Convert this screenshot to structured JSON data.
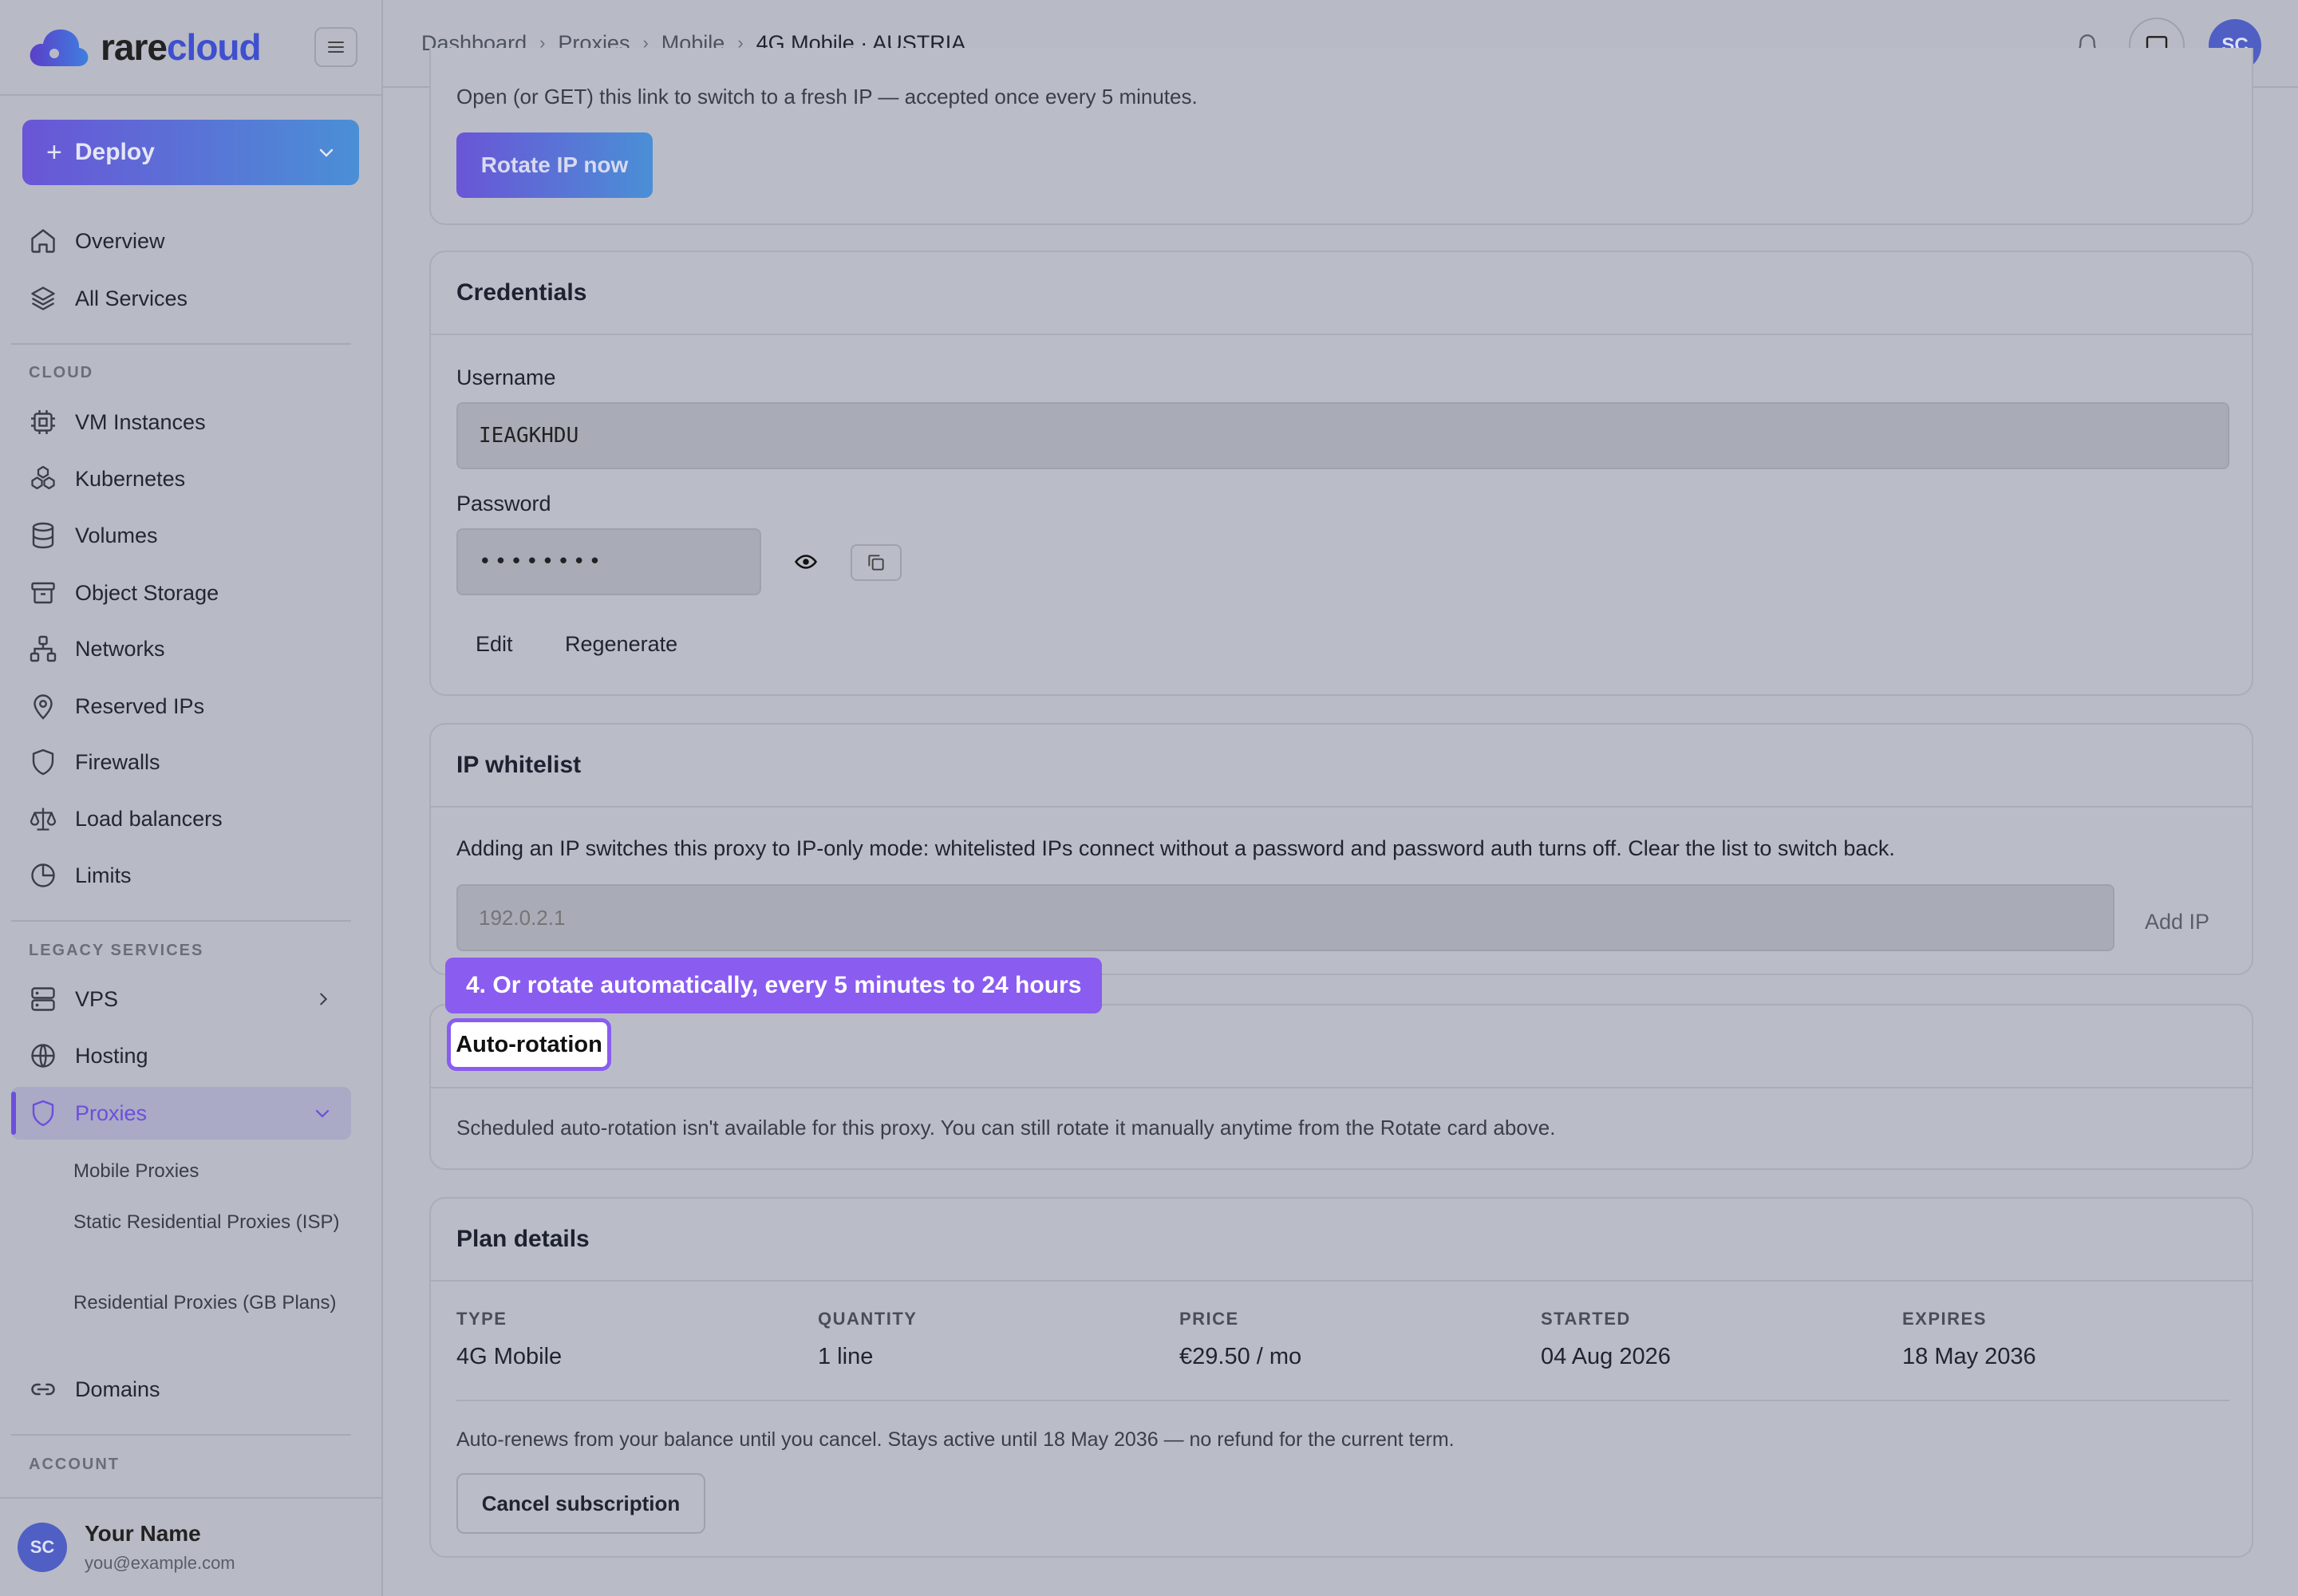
{
  "brand": {
    "name_a": "rare",
    "name_b": "cloud"
  },
  "sidebar": {
    "deploy_label": "Deploy",
    "top_items": [
      {
        "label": "Overview",
        "icon": "home-icon"
      },
      {
        "label": "All Services",
        "icon": "layers-icon"
      }
    ],
    "cloud_label": "CLOUD",
    "cloud_items": [
      {
        "label": "VM Instances",
        "icon": "cpu-icon"
      },
      {
        "label": "Kubernetes",
        "icon": "kubernetes-icon"
      },
      {
        "label": "Volumes",
        "icon": "database-icon"
      },
      {
        "label": "Object Storage",
        "icon": "archive-icon"
      },
      {
        "label": "Networks",
        "icon": "network-icon"
      },
      {
        "label": "Reserved IPs",
        "icon": "map-pin-icon"
      },
      {
        "label": "Firewalls",
        "icon": "shield-icon"
      },
      {
        "label": "Load balancers",
        "icon": "scale-icon"
      },
      {
        "label": "Limits",
        "icon": "pie-chart-icon"
      }
    ],
    "legacy_label": "LEGACY SERVICES",
    "legacy_items": [
      {
        "label": "VPS",
        "icon": "server-icon"
      },
      {
        "label": "Hosting",
        "icon": "globe-icon"
      },
      {
        "label": "Proxies",
        "icon": "shield-icon"
      }
    ],
    "proxy_sub_items": [
      "Mobile Proxies",
      "Static Residential Proxies (ISP)",
      "Residential Proxies (GB Plans)"
    ],
    "domains_label": "Domains",
    "account_label": "ACCOUNT",
    "user": {
      "initials": "SC",
      "name": "Your Name",
      "email": "you@example.com"
    }
  },
  "header": {
    "breadcrumb": [
      "Dashboard",
      "Proxies",
      "Mobile",
      "4G Mobile · AUSTRIA"
    ],
    "avatar_initials": "SC"
  },
  "rotate_card": {
    "hint": "Open (or GET) this link to switch to a fresh IP — accepted once every 5 minutes.",
    "button_label": "Rotate IP now"
  },
  "credentials": {
    "title": "Credentials",
    "username_label": "Username",
    "username_value": "IEAGKHDU",
    "password_label": "Password",
    "password_value": "••••••••",
    "edit_label": "Edit",
    "regenerate_label": "Regenerate"
  },
  "whitelist": {
    "title": "IP whitelist",
    "description": "Adding an IP switches this proxy to IP-only mode: whitelisted IPs connect without a password and password auth turns off. Clear the list to switch back.",
    "input_placeholder": "192.0.2.1",
    "add_label": "Add IP"
  },
  "tour": {
    "tooltip": "4. Or rotate automatically, every 5 minutes to 24 hours"
  },
  "auto_rotation": {
    "title": "Auto-rotation",
    "description": "Scheduled auto-rotation isn't available for this proxy. You can still rotate it manually anytime from the Rotate card above."
  },
  "plan": {
    "title": "Plan details",
    "columns": [
      {
        "header": "TYPE",
        "value": "4G Mobile"
      },
      {
        "header": "QUANTITY",
        "value": "1 line"
      },
      {
        "header": "PRICE",
        "value": "€29.50 / mo"
      },
      {
        "header": "STARTED",
        "value": "04 Aug 2026"
      },
      {
        "header": "EXPIRES",
        "value": "18 May 2036"
      }
    ],
    "note": "Auto-renews from your balance until you cancel. Stays active until 18 May 2036 — no refund for the current term.",
    "cancel_label": "Cancel subscription"
  },
  "colors": {
    "accent": "#8a5cf0",
    "brand_blue": "#3f4fd0"
  }
}
